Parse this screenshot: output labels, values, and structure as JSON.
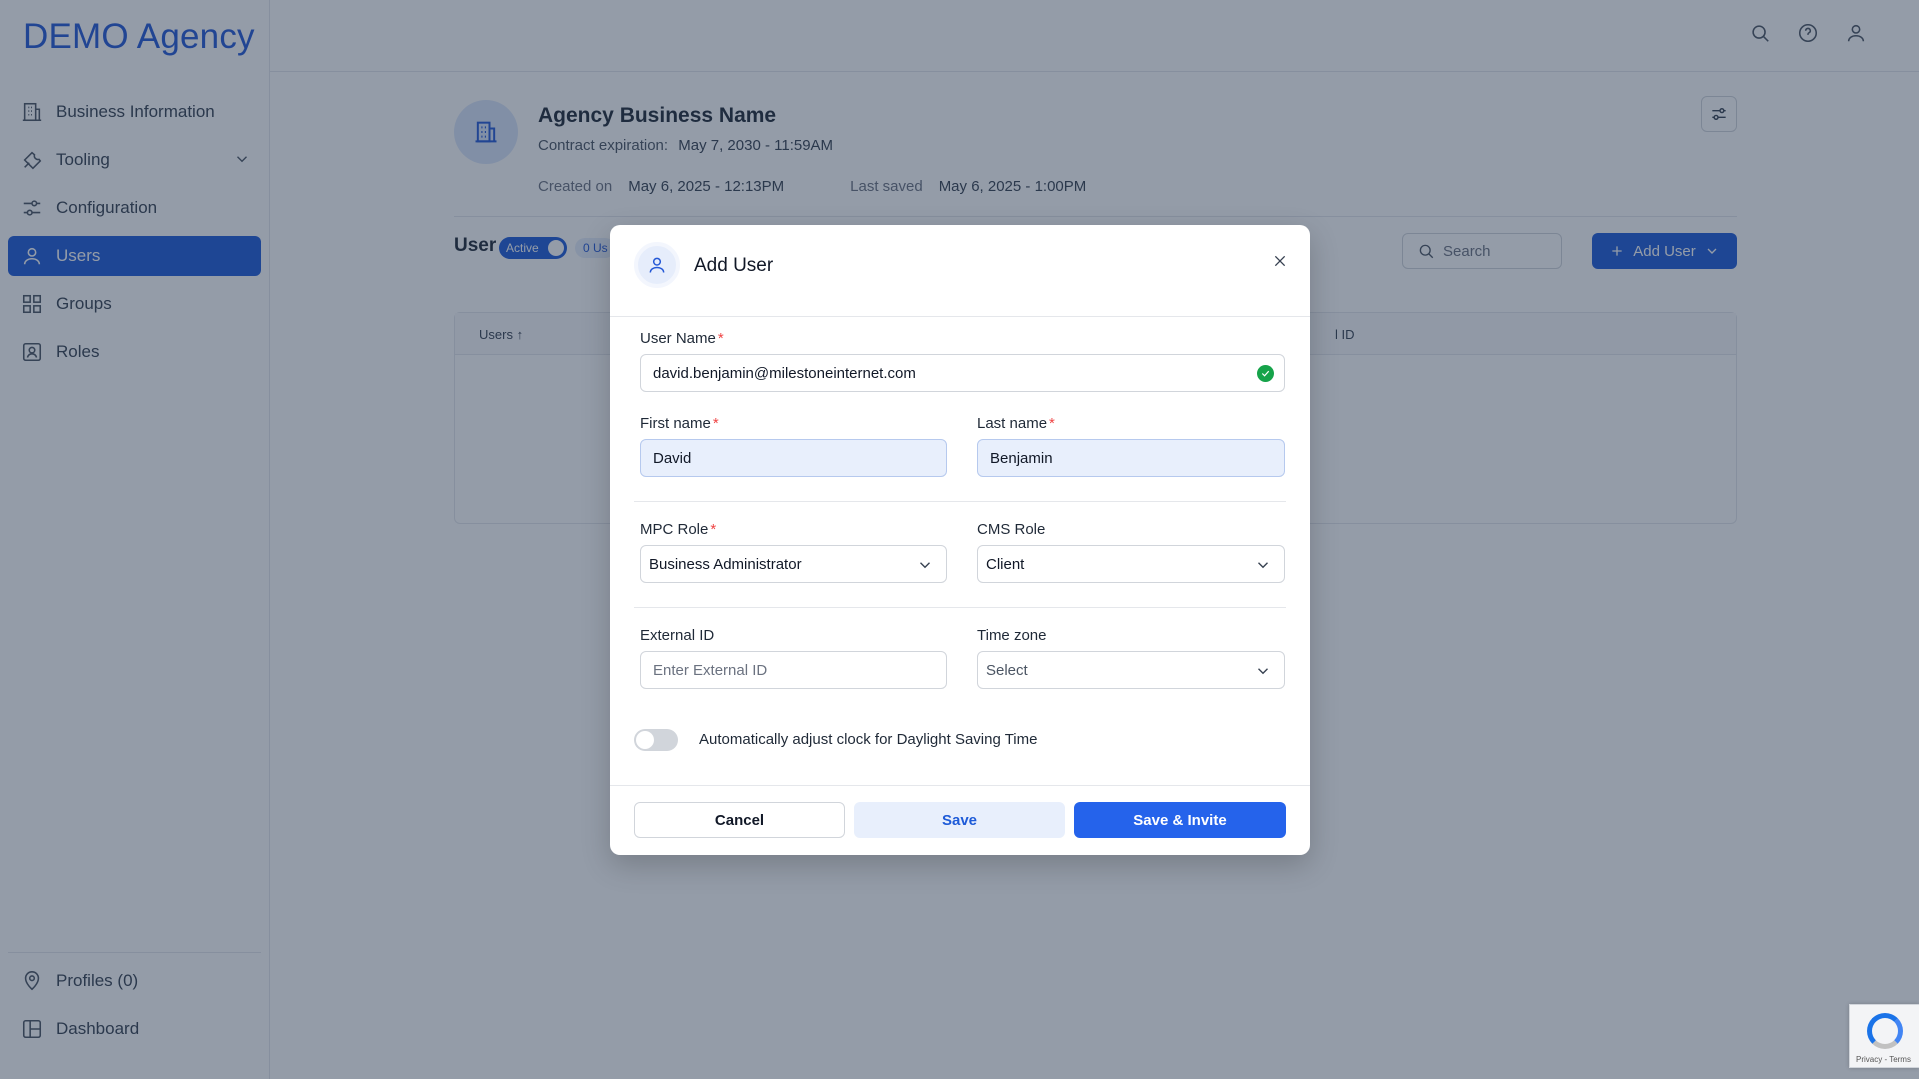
{
  "brand": "DEMO Agency",
  "sidebar": {
    "items": [
      {
        "label": "Business Information",
        "icon": "building-icon"
      },
      {
        "label": "Tooling",
        "icon": "wrench-icon"
      },
      {
        "label": "Configuration",
        "icon": "sliders-icon"
      },
      {
        "label": "Users",
        "icon": "user-icon",
        "active": true
      },
      {
        "label": "Groups",
        "icon": "grid-icon"
      },
      {
        "label": "Roles",
        "icon": "id-badge-icon"
      }
    ],
    "bottom_items": [
      {
        "label": "Profiles (0)",
        "icon": "map-pin-icon"
      },
      {
        "label": "Dashboard",
        "icon": "layout-icon"
      }
    ]
  },
  "business": {
    "title": "Agency Business Name",
    "contract_label": "Contract expiration:",
    "contract_value": "May 7, 2030 - 11:59AM",
    "created_label": "Created on",
    "created_value": "May 6, 2025 - 12:13PM",
    "saved_label": "Last saved",
    "saved_value": "May 6, 2025 - 1:00PM"
  },
  "users_panel": {
    "title": "User",
    "active_label": "Active",
    "count_label": "0 Us",
    "search_placeholder": "Search",
    "add_user_label": "Add User",
    "col_users": "Users",
    "col_external": "l ID"
  },
  "modal": {
    "title": "Add User",
    "username_label": "User Name",
    "username_value": "david.benjamin@milestoneinternet.com",
    "firstname_label": "First name",
    "firstname_value": "David",
    "lastname_label": "Last name",
    "lastname_value": "Benjamin",
    "mpc_role_label": "MPC Role",
    "mpc_role_value": "Business Administrator",
    "cms_role_label": "CMS Role",
    "cms_role_value": "Client",
    "external_id_label": "External ID",
    "external_id_placeholder": "Enter External ID",
    "timezone_label": "Time zone",
    "timezone_value": "Select",
    "dst_label": "Automatically adjust clock for Daylight Saving Time",
    "dst_enabled": false,
    "cancel_label": "Cancel",
    "save_label": "Save",
    "save_invite_label": "Save & Invite"
  },
  "recaptcha_text": "Privacy - Terms",
  "colors": {
    "primary": "#1e5bd8",
    "success": "#16a34a",
    "required": "#ef4444"
  }
}
